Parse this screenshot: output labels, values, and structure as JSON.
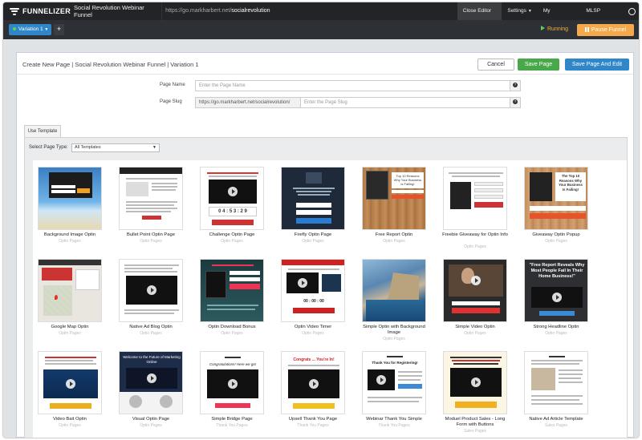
{
  "nav": {
    "logo": "FUNNELIZER",
    "funnel_title": "Social Revolution Webinar Funnel",
    "url_base": "https://go.markharbert.net/",
    "url_slug": "socialrevolution",
    "close_editor": "Close Editor ✖",
    "settings": "Settings",
    "my_account": "My Account",
    "support": "MLSP Support"
  },
  "toolbar": {
    "variation": "Variation 1",
    "add": "+",
    "status": "Running",
    "pause": "Pause Funnel"
  },
  "page": {
    "breadcrumb": "Create New Page  |  Social Revolution Webinar Funnel  |  Variation 1",
    "cancel": "Cancel",
    "save": "Save Page",
    "save_edit": "Save Page And Edit"
  },
  "form": {
    "name_label": "Page Name",
    "name_placeholder": "Enter the Page Name",
    "slug_label": "Page Slug",
    "slug_prefix": "https://go.markharbert.net/socialrevolution/",
    "slug_placeholder": "Enter the Page Slug"
  },
  "templates": {
    "tab": "Use Template",
    "type_label": "Select Page Type:",
    "type_value": "All Templates",
    "items": [
      {
        "name": "Background Image Optin",
        "category": "Optin Pages"
      },
      {
        "name": "Bullet Point Optin Page",
        "category": "Optin Pages"
      },
      {
        "name": "Challenge Optin Page",
        "category": "Optin Pages"
      },
      {
        "name": "Firefly Optin Page",
        "category": "Optin Pages"
      },
      {
        "name": "Free Report Optin",
        "category": "Optin Pages"
      },
      {
        "name": "Freebie Giveaway for Optin Info",
        "category": "Optin Pages"
      },
      {
        "name": "Giveaway Optin Popup",
        "category": "Optin Pages"
      },
      {
        "name": "Google Map Optin",
        "category": "Optin Pages"
      },
      {
        "name": "Native Ad Blog Optin",
        "category": "Optin Pages"
      },
      {
        "name": "Optin Download Bonus",
        "category": "Optin Pages"
      },
      {
        "name": "Optin Video Timer",
        "category": "Optin Pages"
      },
      {
        "name": "Simple Optin with Background Image",
        "category": "Optin Pages"
      },
      {
        "name": "Simple Video Optin",
        "category": "Optin Pages"
      },
      {
        "name": "Strong Headline Optin",
        "category": "Optin Pages"
      },
      {
        "name": "Video Bait Optin",
        "category": "Optin Pages"
      },
      {
        "name": "Visual Optin Page",
        "category": "Optin Pages"
      },
      {
        "name": "Simple Bridge Page",
        "category": "Thank You Pages"
      },
      {
        "name": "Upsell Thank You Page",
        "category": "Thank You Pages"
      },
      {
        "name": "Webinar Thank You Simple",
        "category": "Thank You Pages"
      },
      {
        "name": "Moduel Product Sales - Long Form with Buttons",
        "category": "Sales Pages"
      },
      {
        "name": "Native Ad Article Template",
        "category": "Sales Pages"
      }
    ],
    "thumb_text": {
      "strong_headline": "\"Free Report Reveals Why Most People Fail In Their Home Business!\"",
      "giveaway": "The Top 10 Reasons Why Your Business Is Failing!",
      "free_report": "Top 10 Reasons Why Your Business is Failing!",
      "challenge_timer": "0 4 : 5 3 : 2 9",
      "optin_video_timer": "00 : 00 : 00",
      "visual": "Welcome to the Future of Marketing Online",
      "bridge": "Congratulations! Here we go!",
      "upsell": "Congrats ... You're In!",
      "webinar": "Thank You for Registering!"
    }
  }
}
